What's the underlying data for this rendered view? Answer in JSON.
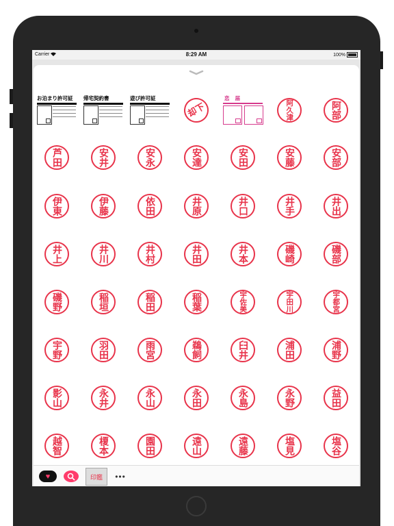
{
  "status_bar": {
    "carrier": "Carrier",
    "time": "8:29 AM",
    "battery": "100%"
  },
  "icons": {
    "grabber": "chevron-down-icon",
    "wifi": "wifi-icon",
    "battery": "battery-icon"
  },
  "colors": {
    "stamp_red": "#e8334a",
    "pink": "#d63a8c",
    "accent": "#ff3b6b"
  },
  "forms": [
    {
      "title": "お泊まり許可証"
    },
    {
      "title": "帰宅契約書"
    },
    {
      "title": "遊び許可証"
    }
  ],
  "special": {
    "rotated_stamp": "却下",
    "pink_form_title": "恋 届"
  },
  "stamps": [
    "阿久津",
    "阿部",
    "芦田",
    "安井",
    "安永",
    "安達",
    "安田",
    "安藤",
    "安部",
    "伊東",
    "伊藤",
    "依田",
    "井原",
    "井口",
    "井手",
    "井出",
    "井上",
    "井川",
    "井村",
    "井田",
    "井本",
    "磯崎",
    "磯部",
    "磯野",
    "稲垣",
    "稲田",
    "稲葉",
    "宇佐美",
    "宇田川",
    "宇都宮",
    "宇野",
    "羽田",
    "雨宮",
    "鵜飼",
    "臼井",
    "浦田",
    "浦野",
    "影山",
    "永井",
    "永山",
    "永田",
    "永島",
    "永野",
    "益田",
    "越智",
    "榎本",
    "園田",
    "遠山",
    "遠藤",
    "塩見",
    "塩谷"
  ],
  "bottom_bar": {
    "thumb_label": "印鑑",
    "more": "•••"
  }
}
